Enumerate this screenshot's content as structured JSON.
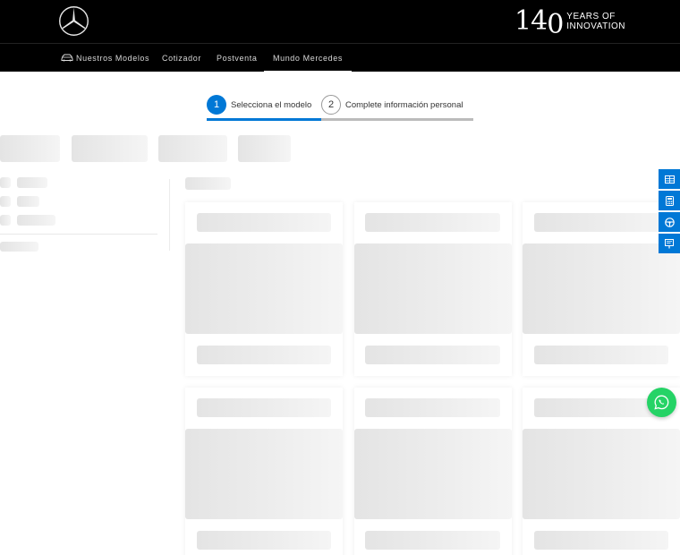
{
  "header": {
    "anniversary": {
      "number": "140",
      "line1": "YEARS OF",
      "line2": "INNOVATION"
    }
  },
  "nav": {
    "items": [
      {
        "label": "Nuestros Modelos",
        "icon": "car-icon"
      },
      {
        "label": "Cotizador"
      },
      {
        "label": "Postventa"
      },
      {
        "label": "Mundo Mercedes",
        "active": true
      }
    ]
  },
  "stepper": {
    "steps": [
      {
        "number": "1",
        "label": "Selecciona el modelo",
        "state": "active"
      },
      {
        "number": "2",
        "label": "Complete información personal",
        "state": "inactive"
      }
    ],
    "progress": 0.43
  },
  "side_tabs": [
    "calculator-table-icon",
    "calculator-icon",
    "steering-wheel-icon",
    "test-drive-sign-icon"
  ],
  "whatsapp": {
    "icon": "whatsapp-icon"
  },
  "colors": {
    "accent": "#0078d6",
    "header_bg": "#000000",
    "whatsapp": "#25d366",
    "skeleton": "#e8e8e8"
  }
}
